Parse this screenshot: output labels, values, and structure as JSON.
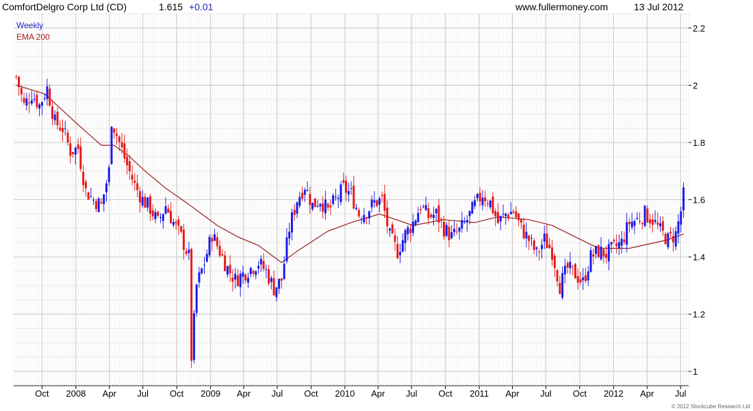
{
  "header": {
    "security": "ComfortDelgro Corp Ltd (CD)",
    "price": "1.615",
    "change": "+0.01",
    "website": "www.fullermoney.com",
    "date": "13 Jul 2012"
  },
  "copyright": "© 2012 Stockcube Research Ltd",
  "colors": {
    "up": "#1a1ae6",
    "down": "#e61a1a",
    "ema": "#9b1c1c",
    "grid": "#dcdcdc",
    "weekly_label": "#2222cc"
  },
  "chart_data": {
    "type": "candlestick",
    "title": "ComfortDelgro Corp Ltd (CD) 1.615 +0.01",
    "legend": [
      {
        "label": "Weekly",
        "color": "#2222cc"
      },
      {
        "label": "EMA 200",
        "color": "#b01818"
      }
    ],
    "legend_position": "top-left",
    "y_axis_side": "right",
    "ylim": [
      0.95,
      2.25
    ],
    "yticks": [
      1,
      1.2,
      1.4,
      1.6,
      1.8,
      2,
      2.2
    ],
    "ytick_labels": [
      "1",
      "1.2",
      "1.4",
      "1.6",
      "1.8",
      "2",
      "2.2"
    ],
    "xticks": [
      {
        "label": "Oct",
        "date": "2007-10-01"
      },
      {
        "label": "2008",
        "date": "2008-01-01"
      },
      {
        "label": "Apr",
        "date": "2008-04-01"
      },
      {
        "label": "Jul",
        "date": "2008-07-01"
      },
      {
        "label": "Oct",
        "date": "2008-10-01"
      },
      {
        "label": "2009",
        "date": "2009-01-01"
      },
      {
        "label": "Apr",
        "date": "2009-04-01"
      },
      {
        "label": "Jul",
        "date": "2009-07-01"
      },
      {
        "label": "Oct",
        "date": "2009-10-01"
      },
      {
        "label": "2010",
        "date": "2010-01-01"
      },
      {
        "label": "Apr",
        "date": "2010-04-01"
      },
      {
        "label": "Jul",
        "date": "2010-07-01"
      },
      {
        "label": "Oct",
        "date": "2010-10-01"
      },
      {
        "label": "2011",
        "date": "2011-01-01"
      },
      {
        "label": "Apr",
        "date": "2011-04-01"
      },
      {
        "label": "Jul",
        "date": "2011-07-01"
      },
      {
        "label": "Oct",
        "date": "2011-10-01"
      },
      {
        "label": "2012",
        "date": "2012-01-01"
      },
      {
        "label": "Apr",
        "date": "2012-04-01"
      },
      {
        "label": "Jul",
        "date": "2012-07-01"
      }
    ],
    "grid": true,
    "close_series": [
      [
        "2007-07-23",
        2.03
      ],
      [
        "2007-08-13",
        1.93
      ],
      [
        "2007-09-03",
        1.97
      ],
      [
        "2007-09-24",
        1.93
      ],
      [
        "2007-10-15",
        1.99
      ],
      [
        "2007-11-05",
        1.87
      ],
      [
        "2007-11-26",
        1.85
      ],
      [
        "2007-12-17",
        1.77
      ],
      [
        "2008-01-07",
        1.78
      ],
      [
        "2008-01-28",
        1.63
      ],
      [
        "2008-02-18",
        1.6
      ],
      [
        "2008-03-10",
        1.58
      ],
      [
        "2008-03-31",
        1.7
      ],
      [
        "2008-04-07",
        1.88
      ],
      [
        "2008-04-28",
        1.8
      ],
      [
        "2008-05-19",
        1.72
      ],
      [
        "2008-06-09",
        1.65
      ],
      [
        "2008-06-30",
        1.6
      ],
      [
        "2008-07-21",
        1.57
      ],
      [
        "2008-08-11",
        1.52
      ],
      [
        "2008-09-01",
        1.58
      ],
      [
        "2008-09-22",
        1.52
      ],
      [
        "2008-10-13",
        1.47
      ],
      [
        "2008-11-03",
        1.4
      ],
      [
        "2008-11-10",
        1.05
      ],
      [
        "2008-11-24",
        1.3
      ],
      [
        "2008-12-15",
        1.38
      ],
      [
        "2009-01-05",
        1.48
      ],
      [
        "2009-01-26",
        1.42
      ],
      [
        "2009-02-16",
        1.36
      ],
      [
        "2009-03-09",
        1.32
      ],
      [
        "2009-03-30",
        1.34
      ],
      [
        "2009-04-20",
        1.36
      ],
      [
        "2009-05-11",
        1.38
      ],
      [
        "2009-06-01",
        1.35
      ],
      [
        "2009-06-22",
        1.29
      ],
      [
        "2009-07-13",
        1.32
      ],
      [
        "2009-08-03",
        1.5
      ],
      [
        "2009-08-24",
        1.6
      ],
      [
        "2009-09-14",
        1.65
      ],
      [
        "2009-10-05",
        1.58
      ],
      [
        "2009-10-26",
        1.6
      ],
      [
        "2009-11-16",
        1.56
      ],
      [
        "2009-12-07",
        1.6
      ],
      [
        "2009-12-28",
        1.64
      ],
      [
        "2010-01-18",
        1.62
      ],
      [
        "2010-02-08",
        1.55
      ],
      [
        "2010-03-01",
        1.56
      ],
      [
        "2010-03-22",
        1.59
      ],
      [
        "2010-04-12",
        1.6
      ],
      [
        "2010-05-03",
        1.47
      ],
      [
        "2010-05-24",
        1.42
      ],
      [
        "2010-06-14",
        1.48
      ],
      [
        "2010-07-05",
        1.52
      ],
      [
        "2010-07-26",
        1.58
      ],
      [
        "2010-08-16",
        1.54
      ],
      [
        "2010-09-06",
        1.55
      ],
      [
        "2010-09-27",
        1.5
      ],
      [
        "2010-10-18",
        1.47
      ],
      [
        "2010-11-08",
        1.49
      ],
      [
        "2010-11-29",
        1.53
      ],
      [
        "2010-12-20",
        1.58
      ],
      [
        "2011-01-10",
        1.62
      ],
      [
        "2011-01-31",
        1.59
      ],
      [
        "2011-02-21",
        1.52
      ],
      [
        "2011-03-14",
        1.55
      ],
      [
        "2011-04-04",
        1.56
      ],
      [
        "2011-04-25",
        1.5
      ],
      [
        "2011-05-16",
        1.46
      ],
      [
        "2011-06-06",
        1.41
      ],
      [
        "2011-06-27",
        1.46
      ],
      [
        "2011-07-18",
        1.42
      ],
      [
        "2011-08-08",
        1.3
      ],
      [
        "2011-08-29",
        1.36
      ],
      [
        "2011-09-19",
        1.34
      ],
      [
        "2011-10-10",
        1.31
      ],
      [
        "2011-10-31",
        1.4
      ],
      [
        "2011-11-21",
        1.42
      ],
      [
        "2011-12-12",
        1.41
      ],
      [
        "2012-01-02",
        1.43
      ],
      [
        "2012-01-23",
        1.45
      ],
      [
        "2012-02-13",
        1.52
      ],
      [
        "2012-03-05",
        1.53
      ],
      [
        "2012-03-26",
        1.55
      ],
      [
        "2012-04-16",
        1.53
      ],
      [
        "2012-05-07",
        1.49
      ],
      [
        "2012-05-28",
        1.46
      ],
      [
        "2012-06-18",
        1.48
      ],
      [
        "2012-07-02",
        1.56
      ],
      [
        "2012-07-09",
        1.615
      ]
    ],
    "ema_series": [
      [
        "2007-07-23",
        2.0
      ],
      [
        "2007-10-08",
        1.97
      ],
      [
        "2007-12-31",
        1.87
      ],
      [
        "2008-03-10",
        1.79
      ],
      [
        "2008-04-14",
        1.79
      ],
      [
        "2008-05-26",
        1.75
      ],
      [
        "2008-07-07",
        1.7
      ],
      [
        "2008-09-01",
        1.64
      ],
      [
        "2008-10-27",
        1.59
      ],
      [
        "2008-12-08",
        1.55
      ],
      [
        "2009-01-19",
        1.51
      ],
      [
        "2009-03-16",
        1.47
      ],
      [
        "2009-05-11",
        1.44
      ],
      [
        "2009-07-13",
        1.38
      ],
      [
        "2009-08-24",
        1.42
      ],
      [
        "2009-11-16",
        1.49
      ],
      [
        "2010-01-18",
        1.52
      ],
      [
        "2010-04-05",
        1.55
      ],
      [
        "2010-07-05",
        1.51
      ],
      [
        "2010-09-27",
        1.53
      ],
      [
        "2010-12-20",
        1.52
      ],
      [
        "2011-02-21",
        1.54
      ],
      [
        "2011-05-16",
        1.53
      ],
      [
        "2011-07-18",
        1.51
      ],
      [
        "2011-09-19",
        1.47
      ],
      [
        "2011-11-21",
        1.43
      ],
      [
        "2012-02-13",
        1.43
      ],
      [
        "2012-05-28",
        1.46
      ],
      [
        "2012-07-09",
        1.48
      ]
    ]
  }
}
